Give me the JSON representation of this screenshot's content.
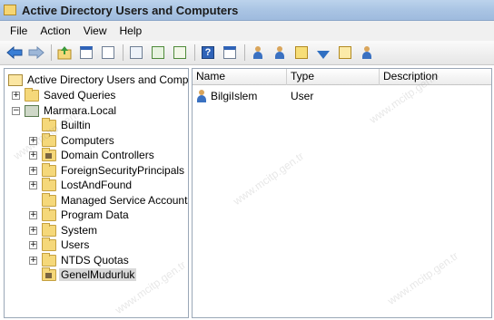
{
  "window": {
    "title": "Active Directory Users and Computers"
  },
  "menu": [
    "File",
    "Action",
    "View",
    "Help"
  ],
  "toolbar": {
    "buttons": [
      "back-arrow-icon",
      "forward-arrow-icon",
      "up-folder-icon",
      "console-tree-icon",
      "properties-icon",
      "export-icon",
      "refresh-icon",
      "export-list-icon",
      "help-icon",
      "mmc-icon",
      "new-user-icon",
      "new-group-icon",
      "new-ou-icon",
      "filter-icon",
      "find-icon",
      "add-to-group-icon"
    ],
    "help_glyph": "?"
  },
  "tree": {
    "root": "Active Directory Users and Comput",
    "saved_queries": "Saved Queries",
    "domain": "Marmara.Local",
    "children": [
      {
        "label": "Builtin",
        "expandable": false
      },
      {
        "label": "Computers",
        "expandable": true
      },
      {
        "label": "Domain Controllers",
        "expandable": true
      },
      {
        "label": "ForeignSecurityPrincipals",
        "expandable": true
      },
      {
        "label": "LostAndFound",
        "expandable": true
      },
      {
        "label": "Managed Service Accounts",
        "expandable": false
      },
      {
        "label": "Program Data",
        "expandable": true
      },
      {
        "label": "System",
        "expandable": true
      },
      {
        "label": "Users",
        "expandable": true
      },
      {
        "label": "NTDS Quotas",
        "expandable": true
      },
      {
        "label": "GenelMudurluk",
        "expandable": false,
        "selected": true
      }
    ]
  },
  "list": {
    "columns": [
      "Name",
      "Type",
      "Description"
    ],
    "rows": [
      {
        "name": "BilgiIslem",
        "type": "User",
        "description": ""
      }
    ]
  },
  "watermark": "www.mcitp.gen.tr"
}
